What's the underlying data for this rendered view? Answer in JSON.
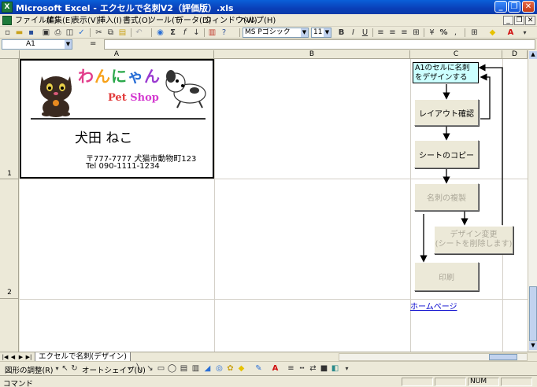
{
  "window": {
    "title": "Microsoft Excel - エクセルで名刺V2（評価版）.xls",
    "app_icon": "X"
  },
  "menu": {
    "items": [
      "ファイル(F)",
      "編集(E)",
      "表示(V)",
      "挿入(I)",
      "書式(O)",
      "ツール(T)",
      "データ(D)",
      "ウィンドウ(W)",
      "ヘルプ(H)"
    ]
  },
  "toolbar": {
    "font_name": "MS Pゴシック",
    "font_size": "11"
  },
  "formula_bar": {
    "name_box": "A1",
    "fx": "=",
    "value": ""
  },
  "grid": {
    "columns": [
      "A",
      "B",
      "C",
      "D"
    ],
    "rows": [
      "1",
      "2"
    ]
  },
  "card": {
    "logo_chars": [
      "わ",
      "ん",
      "に",
      "ゃ",
      "ん"
    ],
    "pet_shop_word1": "Pet",
    "pet_shop_word2": "Shop",
    "name": "犬田 ねこ",
    "address": "〒777-7777 犬猫市動物町123",
    "tel": "Tel 090-1111-1234"
  },
  "flow": {
    "note": "A1のセルに名刺をデザインする",
    "btn_layout": "レイアウト確認",
    "btn_copy_sheet": "シートのコピー",
    "btn_duplicate": "名刺の複製",
    "btn_design_change_l1": "デザイン変更",
    "btn_design_change_l2": "(シートを削除します)",
    "btn_print": "印刷",
    "home_link": "ホームページ"
  },
  "sheet_tabs": {
    "active": "エクセルで名刺(デザイン)"
  },
  "drawing_toolbar": {
    "draw_menu": "図形の調整(R)",
    "autoshape_menu": "オートシェイプ(U)"
  },
  "status": {
    "mode": "コマンド",
    "num": "NUM"
  }
}
